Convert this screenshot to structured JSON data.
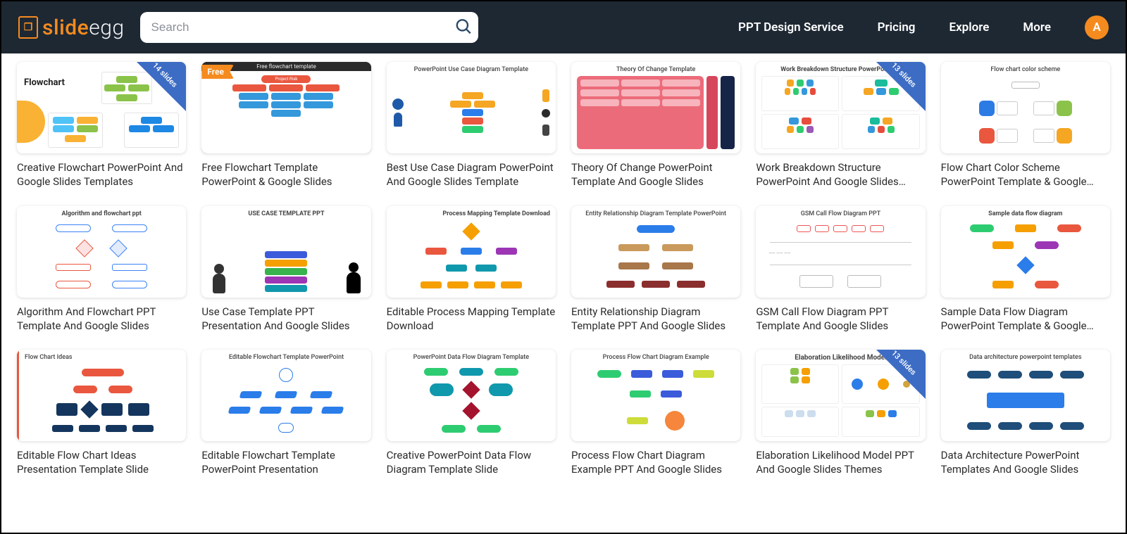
{
  "header": {
    "logo_slide": "slide",
    "logo_egg": "egg",
    "search_placeholder": "Search",
    "nav": {
      "design": "PPT Design Service",
      "pricing": "Pricing",
      "explore": "Explore",
      "more": "More"
    },
    "avatar_letter": "A"
  },
  "templates": [
    {
      "title": "Creative Flowchart PowerPoint And Google Slides Templates",
      "ribbon": "14 slides",
      "free": false,
      "thumb_heading": "Flowchart"
    },
    {
      "title": "Free Flowchart Template PowerPoint & Google Slides",
      "ribbon": null,
      "free": true,
      "thumb_heading": "Free flowchart template",
      "thumb_sub": "Project Risk"
    },
    {
      "title": "Best Use Case Diagram PowerPoint And Google Slides Template",
      "ribbon": null,
      "free": false,
      "thumb_heading": "PowerPoint Use Case Diagram Template"
    },
    {
      "title": "Theory Of Change PowerPoint Template And Google Slides",
      "ribbon": null,
      "free": false,
      "thumb_heading": "Theory Of Change Template"
    },
    {
      "title": "Work Breakdown Structure PowerPoint And Google Slides…",
      "ribbon": "13 slides",
      "free": false,
      "thumb_heading": "Work Breakdown Structure PowerPoint Template"
    },
    {
      "title": "Flow Chart Color Scheme PowerPoint Template & Google…",
      "ribbon": null,
      "free": false,
      "thumb_heading": "Flow chart color scheme"
    },
    {
      "title": "Algorithm And Flowchart PPT Template And Google Slides",
      "ribbon": null,
      "free": false,
      "thumb_heading": "Algorithm and flowchart ppt"
    },
    {
      "title": "Use Case Template PPT Presentation And Google Slides",
      "ribbon": null,
      "free": false,
      "thumb_heading": "USE CASE TEMPLATE PPT"
    },
    {
      "title": "Editable Process Mapping Template Download",
      "ribbon": null,
      "free": false,
      "thumb_heading": "Process Mapping Template Download"
    },
    {
      "title": "Entity Relationship Diagram Template PPT And Google Slides",
      "ribbon": null,
      "free": false,
      "thumb_heading": "Entity Relationship Diagram Template PowerPoint"
    },
    {
      "title": "GSM Call Flow Diagram PPT Template And Google Slides",
      "ribbon": null,
      "free": false,
      "thumb_heading": "GSM Call Flow Diagram PPT"
    },
    {
      "title": "Sample Data Flow Diagram PowerPoint Template & Google…",
      "ribbon": null,
      "free": false,
      "thumb_heading": "Sample data flow diagram"
    },
    {
      "title": "Editable Flow Chart Ideas Presentation Template Slide",
      "ribbon": null,
      "free": false,
      "thumb_heading": "Flow Chart Ideas"
    },
    {
      "title": "Editable Flowchart Template PowerPoint Presentation",
      "ribbon": null,
      "free": false,
      "thumb_heading": "Editable Flowchart Template PowerPoint"
    },
    {
      "title": "Creative PowerPoint Data Flow Diagram Template Slide",
      "ribbon": null,
      "free": false,
      "thumb_heading": "PowerPoint Data Flow Diagram Template"
    },
    {
      "title": "Process Flow Chart Diagram Example PPT And Google Slides",
      "ribbon": null,
      "free": false,
      "thumb_heading": "Process Flow Chart Diagram Example"
    },
    {
      "title": "Elaboration Likelihood Model PPT And Google Slides Themes",
      "ribbon": "13 slides",
      "free": false,
      "thumb_heading": "Elaboration Likelihood Model"
    },
    {
      "title": "Data Architecture PowerPoint Templates And Google Slides",
      "ribbon": null,
      "free": false,
      "thumb_heading": "Data architecture powerpoint templates"
    }
  ],
  "free_label": "Free"
}
